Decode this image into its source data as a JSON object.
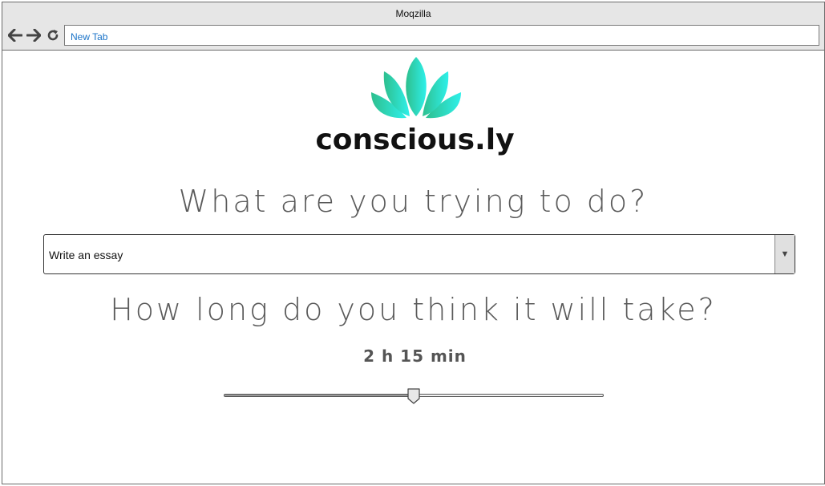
{
  "browser": {
    "title": "Moqzilla",
    "address": "New Tab",
    "icons": {
      "back": "arrow-left-icon",
      "forward": "arrow-right-icon",
      "reload": "reload-icon"
    }
  },
  "app": {
    "logo_text": "conscious.ly",
    "logo_colors": {
      "start": "#2ebf8e",
      "end": "#2ef0ea"
    },
    "question_task": "What are you trying to do?",
    "task_select": {
      "selected": "Write an essay"
    },
    "question_duration": "How long do you think it will take?",
    "duration_label": "2 h 15 min",
    "duration_slider": {
      "fraction": 0.5
    }
  }
}
